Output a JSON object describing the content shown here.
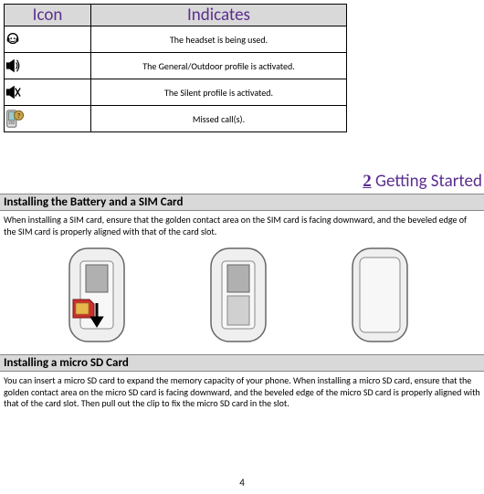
{
  "table": {
    "h_icon": "Icon",
    "h_ind": "Indicates",
    "rows": [
      {
        "ind": "The headset is being used."
      },
      {
        "ind": "The General/Outdoor profile is activated."
      },
      {
        "ind": "The Silent profile is activated."
      },
      {
        "ind": "Missed call(s)."
      }
    ]
  },
  "chapter": {
    "num": "2",
    "title": " Getting Started"
  },
  "section1": {
    "heading": "Installing the Battery and a SIM Card",
    "body": "When installing a SIM card, ensure that the golden contact area on the SIM card is facing downward, and the beveled edge of the SIM card is properly aligned with that of the card slot."
  },
  "section2": {
    "heading": "Installing a micro SD Card",
    "body": "You can insert a micro SD card to expand the memory capacity of your phone. When installing a micro SD card, ensure that the golden contact area on the micro SD card is facing downward, and the beveled edge of the micro SD card is properly aligned with that of the card slot. Then pull out the clip to fix the micro SD card in the slot."
  },
  "page_number": "4"
}
